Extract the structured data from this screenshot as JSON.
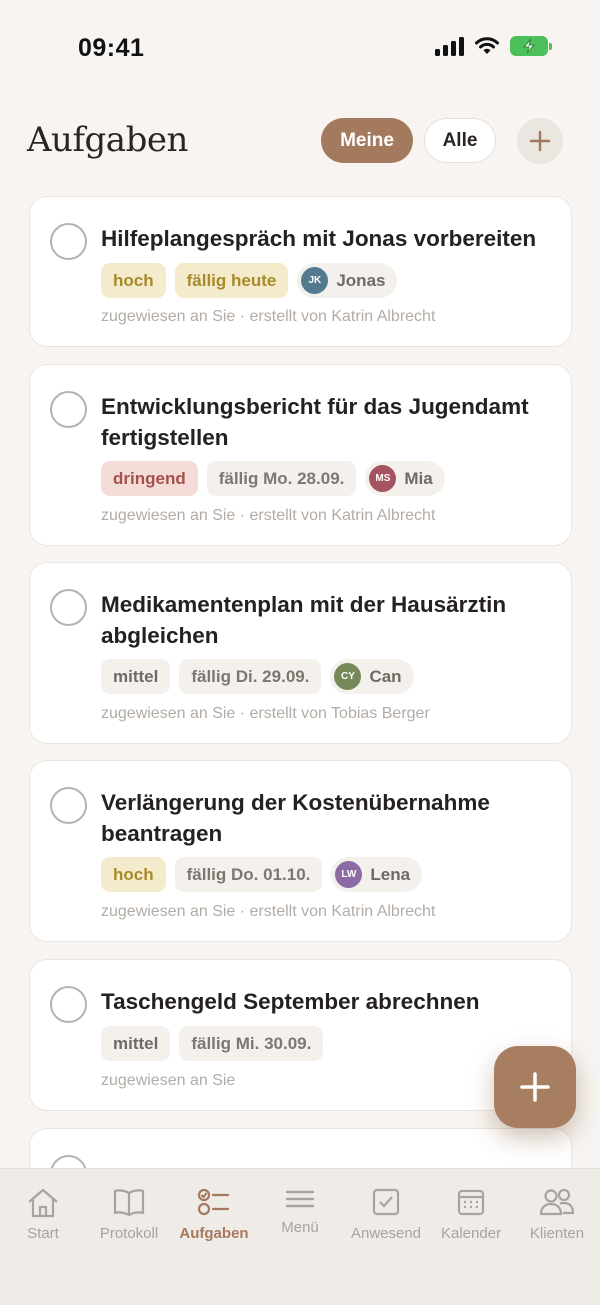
{
  "status_bar": {
    "time": "09:41"
  },
  "header": {
    "title": "Aufgaben",
    "filters": [
      "Meine",
      "Alle"
    ],
    "add_label": "+"
  },
  "tasks": [
    {
      "title": "Hilfeplangespräch mit Jonas vorbereiten",
      "priority": "hoch",
      "due": "fällig heute",
      "client": {
        "initials": "JK",
        "name": "Jonas",
        "color": "#547a90"
      },
      "meta": "zugewiesen an Sie · erstellt von Katrin Albrecht"
    },
    {
      "title": "Entwicklungsbericht für das Jugendamt fertigstellen",
      "priority": "dringend",
      "due": "fällig Mo. 28.09.",
      "client": {
        "initials": "MS",
        "name": "Mia",
        "color": "#a55360"
      },
      "meta": "zugewiesen an Sie · erstellt von Katrin Albrecht"
    },
    {
      "title": "Medikamentenplan mit der Hausärztin abgleichen",
      "priority": "mittel",
      "due": "fällig Di. 29.09.",
      "client": {
        "initials": "CY",
        "name": "Can",
        "color": "#758a58"
      },
      "meta": "zugewiesen an Sie · erstellt von Tobias Berger"
    },
    {
      "title": "Verlängerung der Kostenübernahme beantragen",
      "priority": "hoch",
      "due": "fällig Do. 01.10.",
      "client": {
        "initials": "LW",
        "name": "Lena",
        "color": "#8c6aa3"
      },
      "meta": "zugewiesen an Sie · erstellt von Katrin Albrecht"
    },
    {
      "title": "Taschengeld September abrechnen",
      "priority": "mittel",
      "due": "fällig Mi. 30.09.",
      "meta": "zugewiesen an Sie"
    }
  ],
  "tabs": [
    "Start",
    "Protokoll",
    "Aufgaben",
    "Menü",
    "Anwesend",
    "Kalender",
    "Klienten"
  ],
  "colors": {
    "accent": "#a47a5e",
    "background": "#f7f4f1"
  }
}
